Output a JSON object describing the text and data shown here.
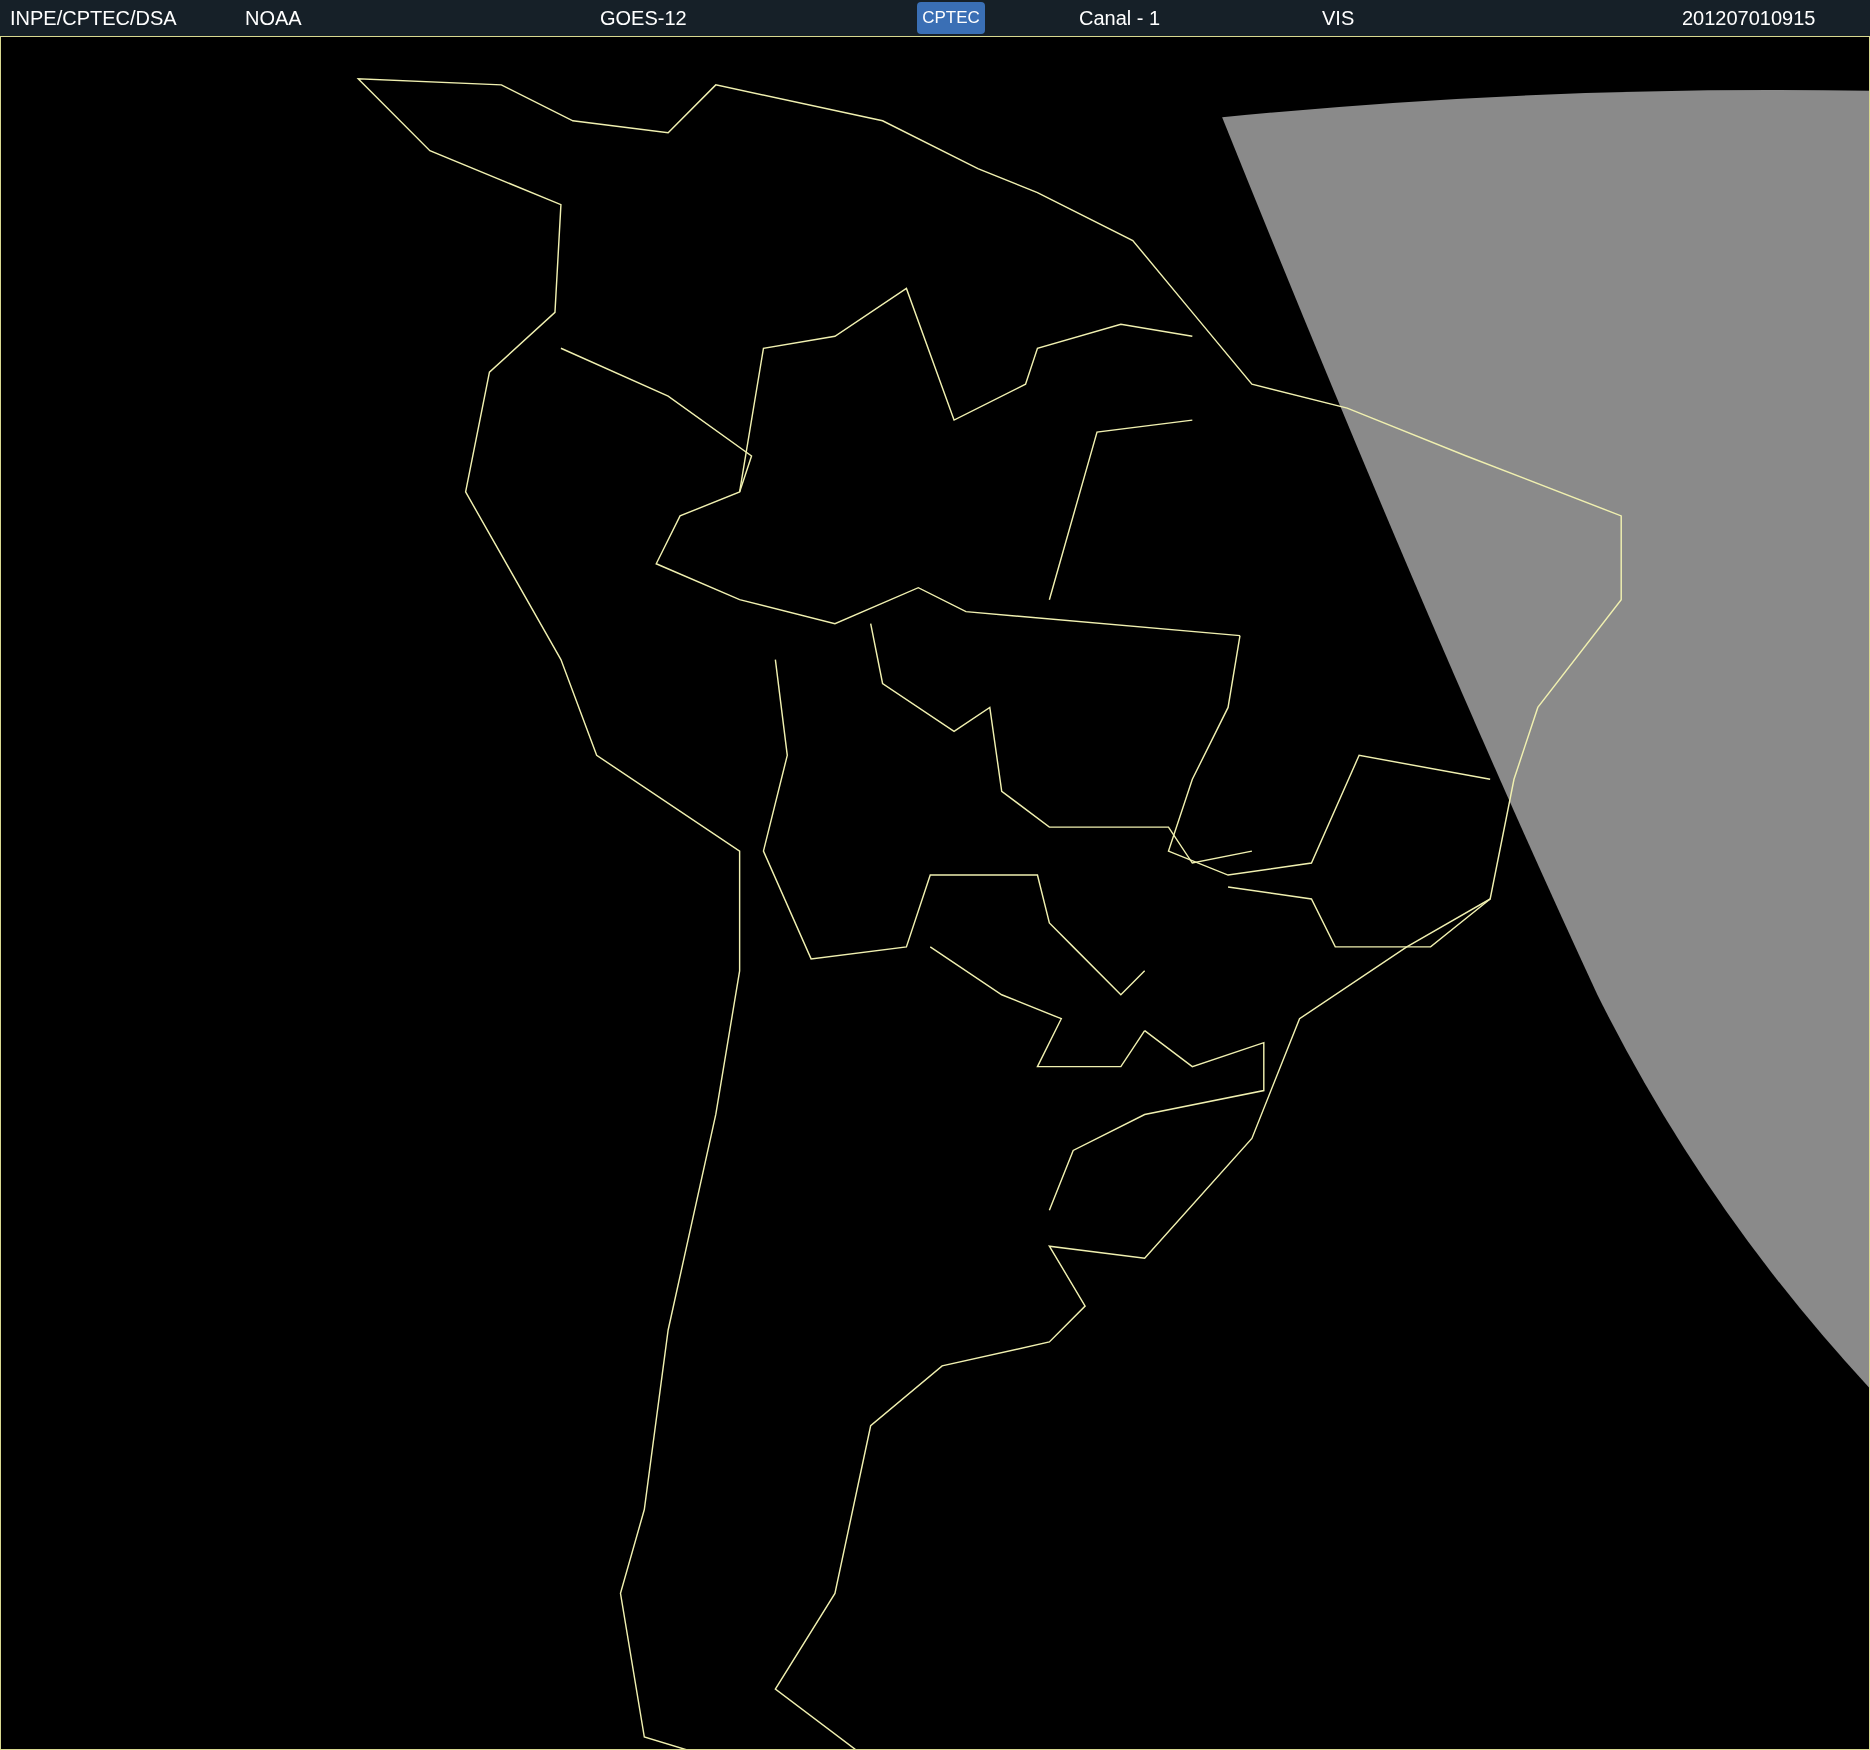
{
  "header": {
    "source": "INPE/CPTEC/DSA",
    "agency": "NOAA",
    "satellite": "GOES-12",
    "logo": "CPTEC",
    "channel": "Canal - 1",
    "band": "VIS",
    "timestamp": "201207010915"
  }
}
